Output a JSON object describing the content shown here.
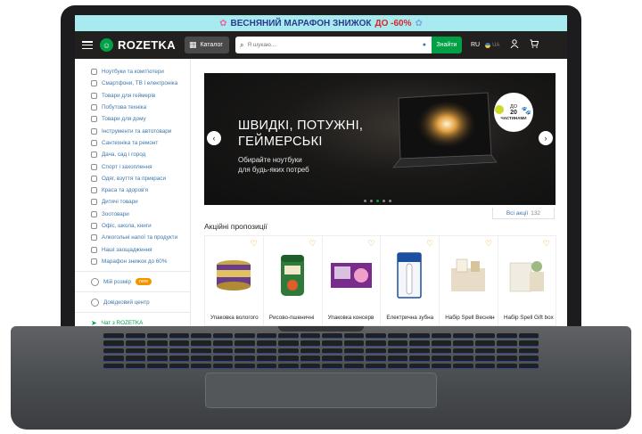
{
  "promo": {
    "text": "ВЕСНЯНИЙ МАРАФОН ЗНИЖОК",
    "discount": "ДО -60%"
  },
  "header": {
    "logo": "ROZETKA",
    "catalog_label": "Каталог",
    "search_placeholder": "Я шукаю...",
    "search_button": "Знайти",
    "lang_ru": "RU",
    "lang_ua": "UA"
  },
  "sidebar": {
    "categories": [
      "Ноутбуки та комп'ютери",
      "Смартфони, ТВ і електроніка",
      "Товари для геймерів",
      "Побутова техніка",
      "Товари для дому",
      "Інструменти та автотовари",
      "Сантехніка та ремонт",
      "Дача, сад і город",
      "Спорт і захоплення",
      "Одяг, взуття та прикраси",
      "Краса та здоров'я",
      "Дитячі товари",
      "Зоотовари",
      "Офіс, школа, книги",
      "Алкогольні напої та продукти",
      "Наші заощадження",
      "Марафон знижок до 60%"
    ],
    "my_size": "Мій розмір",
    "new_badge": "new",
    "help_center": "Довідковий центр",
    "chat": "Чат з ROZETKA"
  },
  "hero": {
    "title_line1": "ШВИДКІ, ПОТУЖНІ,",
    "title_line2": "ГЕЙМЕРСЬКІ",
    "sub_line1": "Обирайте ноутбуки",
    "sub_line2": "для будь-яких потреб",
    "sticker_top": "ДО",
    "sticker_mid": "20",
    "sticker_bottom": "ЧАСТИНАМИ"
  },
  "all_actions": {
    "label": "Всі акції",
    "count": "132"
  },
  "offers": {
    "title": "Акційні пропозиції",
    "products": [
      {
        "name": "Упаковка вологого"
      },
      {
        "name": "Рисово-пшеничні"
      },
      {
        "name": "Упаковка консерв"
      },
      {
        "name": "Електрична зубна"
      },
      {
        "name": "Набір Spell Весняне"
      },
      {
        "name": "Набір Spell Gift box Ii"
      }
    ]
  },
  "colors": {
    "brand_green": "#00a046",
    "header_dark": "#221f1f",
    "link_blue": "#3e77aa",
    "heart_orange": "#f49500"
  }
}
